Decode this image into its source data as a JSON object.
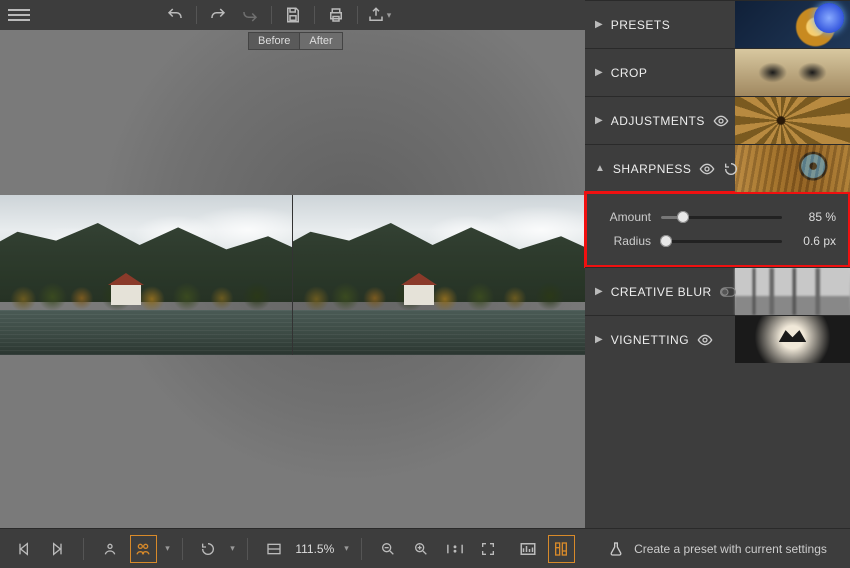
{
  "toolbar": {
    "icons": {
      "menu": "menu",
      "undo": "undo",
      "redo": "redo",
      "redo2": "redo-alt",
      "save": "save",
      "print": "print",
      "export": "export",
      "cart": "cart",
      "grid": "grid"
    }
  },
  "compare": {
    "before": "Before",
    "after": "After"
  },
  "bottom": {
    "zoom_value": "111.5%"
  },
  "panel": {
    "presets": {
      "label": "PRESETS"
    },
    "crop": {
      "label": "CROP"
    },
    "adjustments": {
      "label": "ADJUSTMENTS"
    },
    "sharpness": {
      "label": "SHARPNESS"
    },
    "creative": {
      "label": "CREATIVE BLUR"
    },
    "vignetting": {
      "label": "VIGNETTING"
    }
  },
  "sharpness": {
    "amount": {
      "label": "Amount",
      "value": "85 %",
      "pct": 18
    },
    "radius": {
      "label": "Radius",
      "value": "0.6 px",
      "pct": 4
    }
  },
  "footer": {
    "create_preset": "Create a preset with current settings"
  }
}
